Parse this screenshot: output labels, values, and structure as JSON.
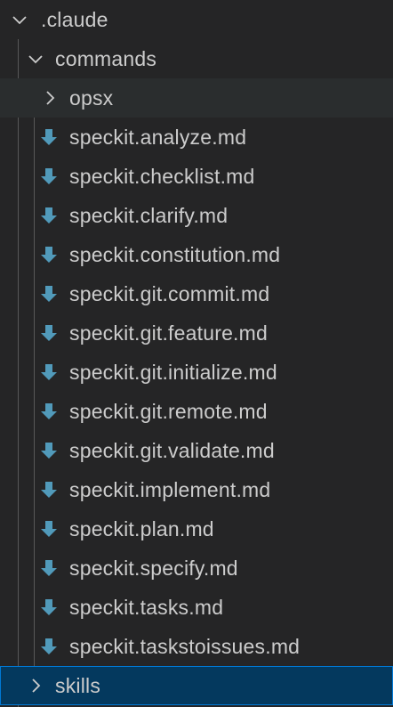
{
  "explorer": {
    "root": {
      "label": ".claude",
      "expanded": true,
      "chevron_icon": "chevron-down-icon"
    },
    "commands": {
      "label": "commands",
      "expanded": true,
      "chevron_icon": "chevron-down-icon"
    },
    "opsx": {
      "label": "opsx",
      "expanded": false,
      "chevron_icon": "chevron-right-icon"
    },
    "files": [
      {
        "label": "speckit.analyze.md",
        "icon": "markdown-download-icon"
      },
      {
        "label": "speckit.checklist.md",
        "icon": "markdown-download-icon"
      },
      {
        "label": "speckit.clarify.md",
        "icon": "markdown-download-icon"
      },
      {
        "label": "speckit.constitution.md",
        "icon": "markdown-download-icon"
      },
      {
        "label": "speckit.git.commit.md",
        "icon": "markdown-download-icon"
      },
      {
        "label": "speckit.git.feature.md",
        "icon": "markdown-download-icon"
      },
      {
        "label": "speckit.git.initialize.md",
        "icon": "markdown-download-icon"
      },
      {
        "label": "speckit.git.remote.md",
        "icon": "markdown-download-icon"
      },
      {
        "label": "speckit.git.validate.md",
        "icon": "markdown-download-icon"
      },
      {
        "label": "speckit.implement.md",
        "icon": "markdown-download-icon"
      },
      {
        "label": "speckit.plan.md",
        "icon": "markdown-download-icon"
      },
      {
        "label": "speckit.specify.md",
        "icon": "markdown-download-icon"
      },
      {
        "label": "speckit.tasks.md",
        "icon": "markdown-download-icon"
      },
      {
        "label": "speckit.taskstoissues.md",
        "icon": "markdown-download-icon"
      }
    ],
    "skills": {
      "label": "skills",
      "expanded": false,
      "selected": true,
      "chevron_icon": "chevron-right-icon"
    }
  },
  "colors": {
    "background": "#252526",
    "hover_row": "#2a2d2e",
    "selected_row": "#04395e",
    "selected_border": "#0078d4",
    "text": "#cccccc",
    "file_icon": "#519aba",
    "indent_guide": "#585858"
  }
}
